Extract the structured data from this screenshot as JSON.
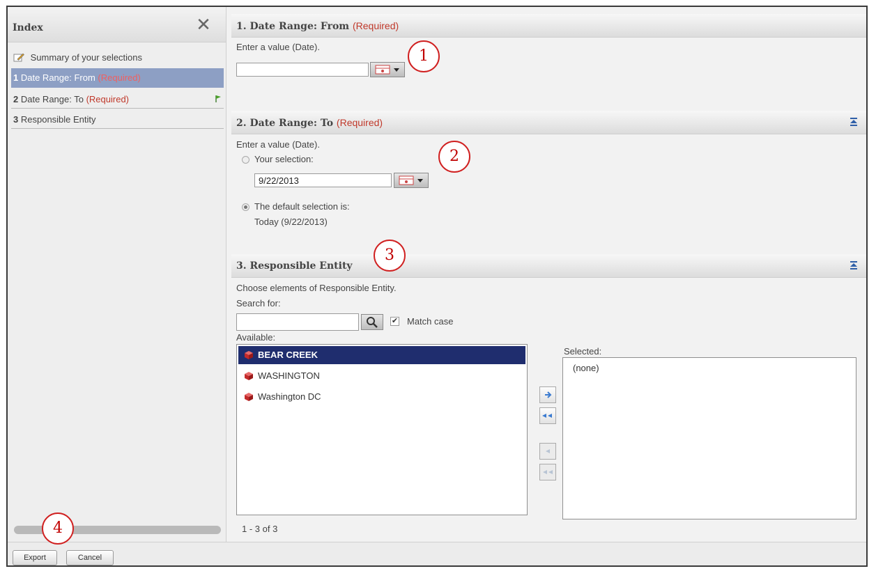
{
  "sidebar": {
    "title": "Index",
    "close_icon": "x-close-icon",
    "summary_label": "Summary of your selections",
    "items": [
      {
        "num": "1",
        "label": "Date Range: From",
        "required": "(Required)"
      },
      {
        "num": "2",
        "label": "Date Range: To",
        "required": "(Required)"
      },
      {
        "num": "3",
        "label": "Responsible Entity",
        "required": ""
      }
    ]
  },
  "sections": [
    {
      "title": "1. Date Range: From",
      "required": "(Required)",
      "prompt": "Enter a value (Date).",
      "value": ""
    },
    {
      "title": "2. Date Range: To",
      "required": "(Required)",
      "prompt": "Enter a value (Date).",
      "your_selection_label": "Your selection:",
      "value": "9/22/2013",
      "default_label": "The default selection is:",
      "default_value": "Today (9/22/2013)"
    },
    {
      "title": "3. Responsible Entity",
      "required": "",
      "prompt": "Choose elements of Responsible Entity.",
      "search_label": "Search for:",
      "search_value": "",
      "match_case_label": "Match case",
      "match_case_checked": true,
      "available_label": "Available:",
      "selected_label": "Selected:",
      "available": [
        "BEAR CREEK",
        "WASHINGTON",
        "Washington DC"
      ],
      "selected": [
        "(none)"
      ],
      "count_text": "1 - 3 of 3"
    }
  ],
  "callouts": [
    "1",
    "2",
    "3",
    "4"
  ],
  "buttons": {
    "export": "Export",
    "cancel": "Cancel"
  },
  "colors": {
    "required": "#c0392b",
    "selected_row": "#1f2d6e",
    "active_index_item": "#8d9fc4",
    "callout": "#d02020"
  }
}
